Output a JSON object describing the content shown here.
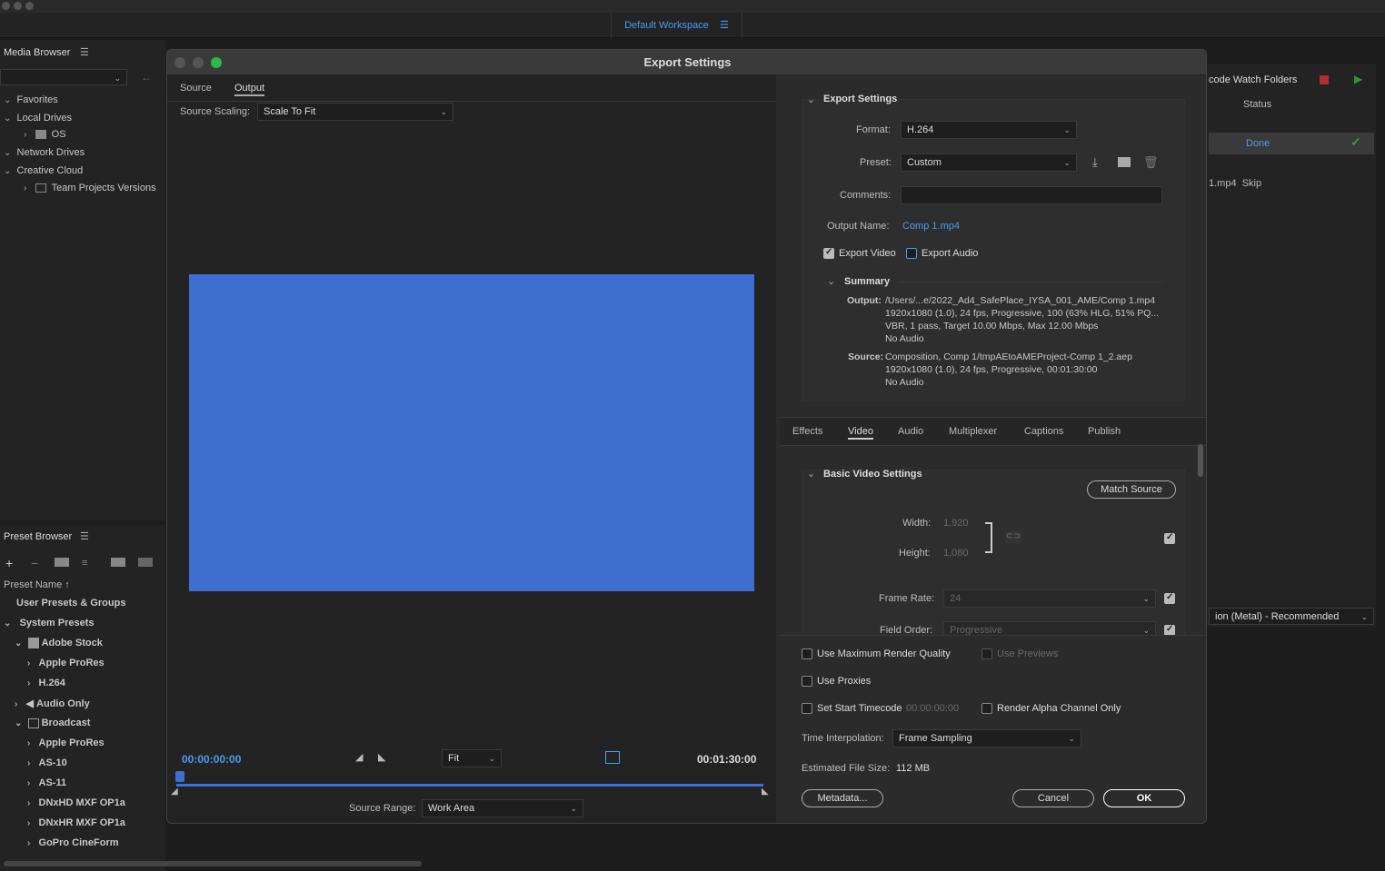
{
  "workspace": {
    "label": "Default Workspace"
  },
  "media_browser": {
    "title": "Media Browser",
    "items": [
      "Favorites",
      "Local Drives",
      "OS",
      "Network Drives",
      "Creative Cloud",
      "Team Projects Versions"
    ]
  },
  "preset_browser": {
    "title": "Preset Browser",
    "column": "Preset Name",
    "user_presets": "User Presets & Groups",
    "system_presets": "System Presets",
    "adobe_stock": "Adobe Stock",
    "apple_prores": "Apple ProRes",
    "h264": "H.264",
    "audio_only": "Audio Only",
    "broadcast": "Broadcast",
    "broadcast_items": [
      "Apple ProRes",
      "AS-10",
      "AS-11",
      "DNxHD MXF OP1a",
      "DNxHR MXF OP1a",
      "GoPro CineForm"
    ]
  },
  "queue": {
    "watch_folders": "code Watch Folders",
    "status_header": "Status",
    "status": "Done",
    "file": "1.mp4",
    "skip": "Skip",
    "renderer": "ion (Metal) - Recommended"
  },
  "dialog": {
    "title": "Export Settings",
    "tabs": {
      "source": "Source",
      "output": "Output"
    },
    "source_scaling_label": "Source Scaling:",
    "source_scaling_value": "Scale To Fit",
    "preview_color": "#3f6ed1",
    "timecode_start": "00:00:00:00",
    "timecode_end": "00:01:30:00",
    "zoom": "Fit",
    "source_range_label": "Source Range:",
    "source_range_value": "Work Area",
    "export_settings": {
      "header": "Export Settings",
      "format_label": "Format:",
      "format_value": "H.264",
      "preset_label": "Preset:",
      "preset_value": "Custom",
      "comments_label": "Comments:",
      "output_name_label": "Output Name:",
      "output_name_value": "Comp 1.mp4",
      "export_video": "Export Video",
      "export_audio": "Export Audio"
    },
    "summary": {
      "header": "Summary",
      "output_label": "Output:",
      "output_lines": [
        "/Users/...e/2022_Ad4_SafePlace_IYSA_001_AME/Comp 1.mp4",
        "1920x1080 (1.0), 24 fps, Progressive, 100 (63% HLG, 51% PQ...",
        "VBR, 1 pass, Target 10.00 Mbps, Max 12.00 Mbps",
        "No Audio"
      ],
      "source_label": "Source:",
      "source_lines": [
        "Composition, Comp 1/tmpAEtoAMEProject-Comp 1_2.aep",
        "1920x1080 (1.0), 24 fps, Progressive, 00:01:30:00",
        "No Audio"
      ]
    },
    "settings_tabs": [
      "Effects",
      "Video",
      "Audio",
      "Multiplexer",
      "Captions",
      "Publish"
    ],
    "video": {
      "header": "Basic Video Settings",
      "match_source": "Match Source",
      "width_label": "Width:",
      "width_value": "1,920",
      "height_label": "Height:",
      "height_value": "1,080",
      "frame_rate_label": "Frame Rate:",
      "frame_rate_value": "24",
      "field_order_label": "Field Order:",
      "field_order_value": "Progressive"
    },
    "options": {
      "max_render": "Use Maximum Render Quality",
      "use_previews": "Use Previews",
      "use_proxies": "Use Proxies",
      "set_start_tc": "Set Start Timecode",
      "start_tc_value": "00:00:00:00",
      "alpha_only": "Render Alpha Channel Only",
      "time_interp_label": "Time Interpolation:",
      "time_interp_value": "Frame Sampling",
      "file_size_label": "Estimated File Size:",
      "file_size_value": "112 MB"
    },
    "buttons": {
      "metadata": "Metadata...",
      "cancel": "Cancel",
      "ok": "OK"
    }
  }
}
